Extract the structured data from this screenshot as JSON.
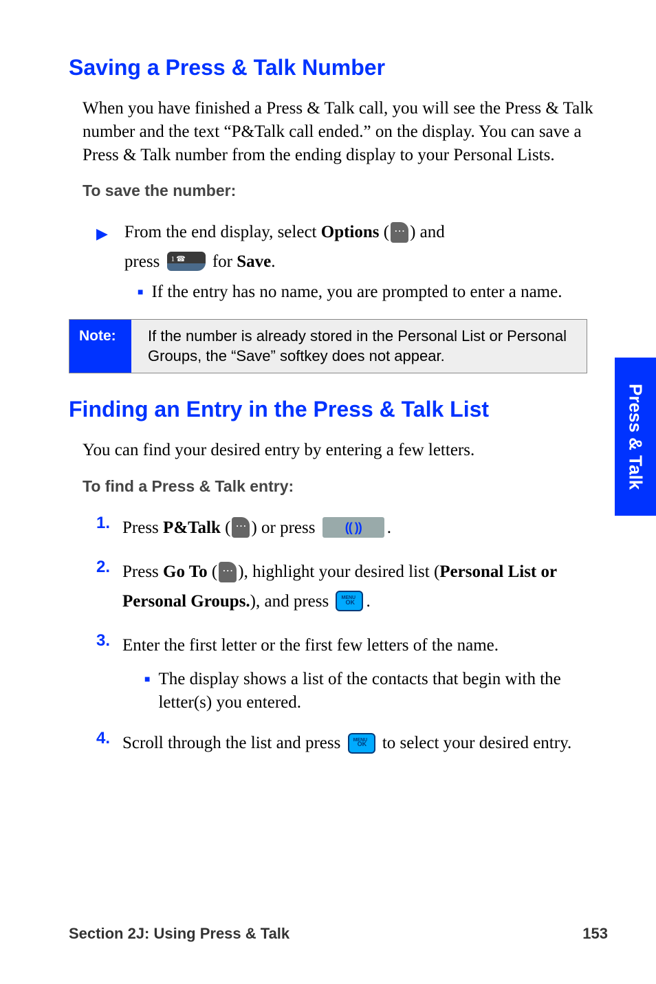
{
  "section1": {
    "heading": "Saving a Press & Talk Number",
    "intro": "When you have finished a Press & Talk call, you will see the Press & Talk number and the text “P&Talk call ended.” on the display. You can save a Press & Talk number from the ending display to your Personal Lists.",
    "subhead": "To save the number:",
    "bullet_pre": "From the end display, select ",
    "options_label": "Options",
    "bullet_mid": " (",
    "bullet_mid2": ") and",
    "bullet_press": "press ",
    "bullet_for": " for ",
    "save_label": "Save",
    "bullet_end": ".",
    "sub_bullet": "If the entry has no name, you are prompted to enter a name."
  },
  "note": {
    "label": "Note:",
    "text": "If the number is already stored in the Personal List or Personal Groups, the “Save” softkey does not appear."
  },
  "section2": {
    "heading": "Finding an Entry in the Press & Talk List",
    "intro": "You can find your desired entry by entering a few letters.",
    "subhead": "To find a Press & Talk entry:",
    "steps": [
      {
        "n": "1.",
        "pre": "Press ",
        "b1": "P&Talk",
        "mid1": " (",
        "mid2": ") or press ",
        "end": "."
      },
      {
        "n": "2.",
        "pre": "Press ",
        "b1": "Go To",
        "mid1": " (",
        "mid2": "), highlight your desired list (",
        "b2": "Personal List or Personal Groups.",
        "mid3": "), and press ",
        "end": "."
      },
      {
        "n": "3.",
        "text": "Enter the first letter or the first few letters of the name.",
        "sub": "The display shows a list of the contacts that begin with the letter(s) you entered."
      },
      {
        "n": "4.",
        "pre": "Scroll through the list and press ",
        "post": " to select your desired entry."
      }
    ]
  },
  "icons": {
    "ptt_label": "(( ))"
  },
  "side_tab": "Press & Talk",
  "footer": {
    "left": "Section 2J: Using Press & Talk",
    "right": "153"
  }
}
